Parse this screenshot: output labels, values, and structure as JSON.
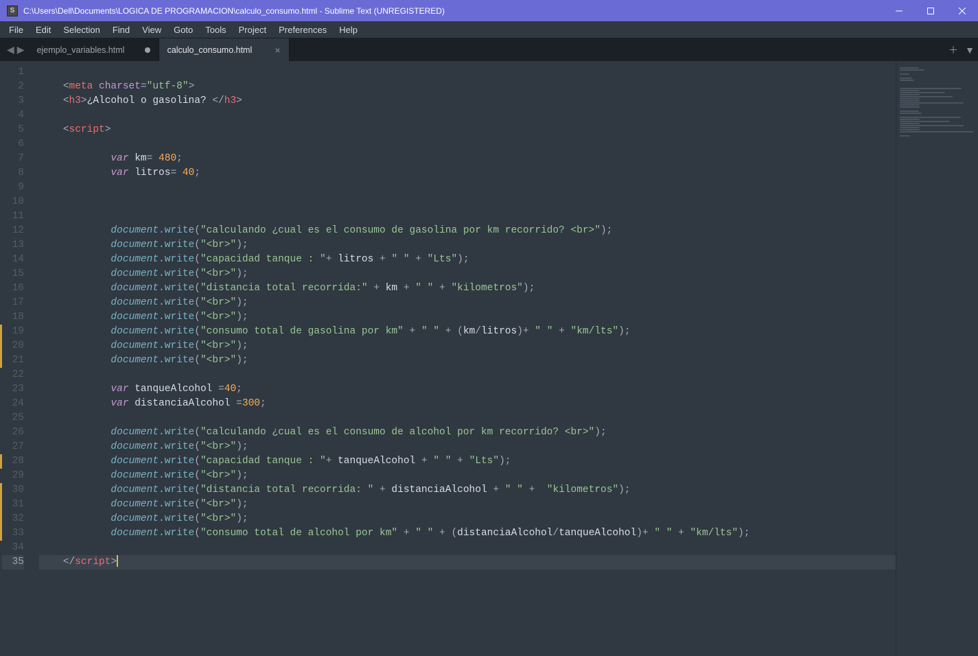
{
  "titlebar": {
    "title": "C:\\Users\\Dell\\Documents\\LOGICA DE PROGRAMACION\\calculo_consumo.html - Sublime Text (UNREGISTERED)"
  },
  "menu": [
    "File",
    "Edit",
    "Selection",
    "Find",
    "View",
    "Goto",
    "Tools",
    "Project",
    "Preferences",
    "Help"
  ],
  "tabs": [
    {
      "label": "ejemplo_variables.html",
      "active": false,
      "dirty": true
    },
    {
      "label": "calculo_consumo.html",
      "active": true,
      "dirty": false
    }
  ],
  "modified_lines": [
    19,
    20,
    21,
    28,
    30,
    31,
    32,
    33
  ],
  "code_lines": [
    {
      "n": 1,
      "segs": []
    },
    {
      "n": 2,
      "segs": [
        {
          "t": "<",
          "c": "pun"
        },
        {
          "t": "meta",
          "c": "tag"
        },
        {
          "t": " ",
          "c": "pun"
        },
        {
          "t": "charset",
          "c": "attr"
        },
        {
          "t": "=",
          "c": "pun"
        },
        {
          "t": "\"utf-8\"",
          "c": "str"
        },
        {
          "t": ">",
          "c": "pun"
        }
      ]
    },
    {
      "n": 3,
      "segs": [
        {
          "t": "<",
          "c": "pun"
        },
        {
          "t": "h3",
          "c": "tag"
        },
        {
          "t": ">",
          "c": "pun"
        },
        {
          "t": "¿Alcohol o gasolina? ",
          "c": "txt"
        },
        {
          "t": "</",
          "c": "pun"
        },
        {
          "t": "h3",
          "c": "tag"
        },
        {
          "t": ">",
          "c": "pun"
        }
      ]
    },
    {
      "n": 4,
      "segs": []
    },
    {
      "n": 5,
      "segs": [
        {
          "t": "<",
          "c": "pun"
        },
        {
          "t": "script",
          "c": "tag"
        },
        {
          "t": ">",
          "c": "pun"
        }
      ]
    },
    {
      "n": 6,
      "segs": []
    },
    {
      "n": 7,
      "indent": 2,
      "segs": [
        {
          "t": "var",
          "c": "kw"
        },
        {
          "t": " km",
          "c": "varn"
        },
        {
          "t": "= ",
          "c": "pun"
        },
        {
          "t": "480",
          "c": "num"
        },
        {
          "t": ";",
          "c": "pun"
        }
      ]
    },
    {
      "n": 8,
      "indent": 2,
      "segs": [
        {
          "t": "var",
          "c": "kw"
        },
        {
          "t": " litros",
          "c": "varn"
        },
        {
          "t": "= ",
          "c": "pun"
        },
        {
          "t": "40",
          "c": "num"
        },
        {
          "t": ";",
          "c": "pun"
        }
      ]
    },
    {
      "n": 9,
      "segs": []
    },
    {
      "n": 10,
      "segs": []
    },
    {
      "n": 11,
      "segs": []
    },
    {
      "n": 12,
      "indent": 2,
      "segs": [
        {
          "t": "document",
          "c": "obj"
        },
        {
          "t": ".",
          "c": "pun"
        },
        {
          "t": "write",
          "c": "mem"
        },
        {
          "t": "(",
          "c": "pun"
        },
        {
          "t": "\"calculando ¿cual es el consumo de gasolina por km recorrido? <br>\"",
          "c": "str"
        },
        {
          "t": ");",
          "c": "pun"
        }
      ]
    },
    {
      "n": 13,
      "indent": 2,
      "segs": [
        {
          "t": "document",
          "c": "obj"
        },
        {
          "t": ".",
          "c": "pun"
        },
        {
          "t": "write",
          "c": "mem"
        },
        {
          "t": "(",
          "c": "pun"
        },
        {
          "t": "\"<br>\"",
          "c": "str"
        },
        {
          "t": ");",
          "c": "pun"
        }
      ]
    },
    {
      "n": 14,
      "indent": 2,
      "segs": [
        {
          "t": "document",
          "c": "obj"
        },
        {
          "t": ".",
          "c": "pun"
        },
        {
          "t": "write",
          "c": "mem"
        },
        {
          "t": "(",
          "c": "pun"
        },
        {
          "t": "\"capacidad tanque : \"",
          "c": "str"
        },
        {
          "t": "+ ",
          "c": "pun"
        },
        {
          "t": "litros",
          "c": "varn"
        },
        {
          "t": " + ",
          "c": "pun"
        },
        {
          "t": "\" \"",
          "c": "str"
        },
        {
          "t": " + ",
          "c": "pun"
        },
        {
          "t": "\"Lts\"",
          "c": "str"
        },
        {
          "t": ");",
          "c": "pun"
        }
      ]
    },
    {
      "n": 15,
      "indent": 2,
      "segs": [
        {
          "t": "document",
          "c": "obj"
        },
        {
          "t": ".",
          "c": "pun"
        },
        {
          "t": "write",
          "c": "mem"
        },
        {
          "t": "(",
          "c": "pun"
        },
        {
          "t": "\"<br>\"",
          "c": "str"
        },
        {
          "t": ");",
          "c": "pun"
        }
      ]
    },
    {
      "n": 16,
      "indent": 2,
      "segs": [
        {
          "t": "document",
          "c": "obj"
        },
        {
          "t": ".",
          "c": "pun"
        },
        {
          "t": "write",
          "c": "mem"
        },
        {
          "t": "(",
          "c": "pun"
        },
        {
          "t": "\"distancia total recorrida:\"",
          "c": "str"
        },
        {
          "t": " + ",
          "c": "pun"
        },
        {
          "t": "km",
          "c": "varn"
        },
        {
          "t": " + ",
          "c": "pun"
        },
        {
          "t": "\" \"",
          "c": "str"
        },
        {
          "t": " + ",
          "c": "pun"
        },
        {
          "t": "\"kilometros\"",
          "c": "str"
        },
        {
          "t": ");",
          "c": "pun"
        }
      ]
    },
    {
      "n": 17,
      "indent": 2,
      "segs": [
        {
          "t": "document",
          "c": "obj"
        },
        {
          "t": ".",
          "c": "pun"
        },
        {
          "t": "write",
          "c": "mem"
        },
        {
          "t": "(",
          "c": "pun"
        },
        {
          "t": "\"<br>\"",
          "c": "str"
        },
        {
          "t": ");",
          "c": "pun"
        }
      ]
    },
    {
      "n": 18,
      "indent": 2,
      "segs": [
        {
          "t": "document",
          "c": "obj"
        },
        {
          "t": ".",
          "c": "pun"
        },
        {
          "t": "write",
          "c": "mem"
        },
        {
          "t": "(",
          "c": "pun"
        },
        {
          "t": "\"<br>\"",
          "c": "str"
        },
        {
          "t": ");",
          "c": "pun"
        }
      ]
    },
    {
      "n": 19,
      "indent": 2,
      "segs": [
        {
          "t": "document",
          "c": "obj"
        },
        {
          "t": ".",
          "c": "pun"
        },
        {
          "t": "write",
          "c": "mem"
        },
        {
          "t": "(",
          "c": "pun"
        },
        {
          "t": "\"consumo total de gasolina por km\"",
          "c": "str"
        },
        {
          "t": " + ",
          "c": "pun"
        },
        {
          "t": "\" \"",
          "c": "str"
        },
        {
          "t": " + (",
          "c": "pun"
        },
        {
          "t": "km",
          "c": "varn"
        },
        {
          "t": "/",
          "c": "pun"
        },
        {
          "t": "litros",
          "c": "varn"
        },
        {
          "t": ")+ ",
          "c": "pun"
        },
        {
          "t": "\" \"",
          "c": "str"
        },
        {
          "t": " + ",
          "c": "pun"
        },
        {
          "t": "\"km/lts\"",
          "c": "str"
        },
        {
          "t": ");",
          "c": "pun"
        }
      ]
    },
    {
      "n": 20,
      "indent": 2,
      "segs": [
        {
          "t": "document",
          "c": "obj"
        },
        {
          "t": ".",
          "c": "pun"
        },
        {
          "t": "write",
          "c": "mem"
        },
        {
          "t": "(",
          "c": "pun"
        },
        {
          "t": "\"<br>\"",
          "c": "str"
        },
        {
          "t": ");",
          "c": "pun"
        }
      ]
    },
    {
      "n": 21,
      "indent": 2,
      "segs": [
        {
          "t": "document",
          "c": "obj"
        },
        {
          "t": ".",
          "c": "pun"
        },
        {
          "t": "write",
          "c": "mem"
        },
        {
          "t": "(",
          "c": "pun"
        },
        {
          "t": "\"<br>\"",
          "c": "str"
        },
        {
          "t": ");",
          "c": "pun"
        }
      ]
    },
    {
      "n": 22,
      "segs": []
    },
    {
      "n": 23,
      "indent": 2,
      "segs": [
        {
          "t": "var",
          "c": "kw"
        },
        {
          "t": " tanqueAlcohol ",
          "c": "varn"
        },
        {
          "t": "=",
          "c": "pun"
        },
        {
          "t": "40",
          "c": "num"
        },
        {
          "t": ";",
          "c": "pun"
        }
      ]
    },
    {
      "n": 24,
      "indent": 2,
      "segs": [
        {
          "t": "var",
          "c": "kw"
        },
        {
          "t": " distanciaAlcohol ",
          "c": "varn"
        },
        {
          "t": "=",
          "c": "pun"
        },
        {
          "t": "300",
          "c": "num"
        },
        {
          "t": ";",
          "c": "pun"
        }
      ]
    },
    {
      "n": 25,
      "segs": []
    },
    {
      "n": 26,
      "indent": 2,
      "segs": [
        {
          "t": "document",
          "c": "obj"
        },
        {
          "t": ".",
          "c": "pun"
        },
        {
          "t": "write",
          "c": "mem"
        },
        {
          "t": "(",
          "c": "pun"
        },
        {
          "t": "\"calculando ¿cual es el consumo de alcohol por km recorrido? <br>\"",
          "c": "str"
        },
        {
          "t": ");",
          "c": "pun"
        }
      ]
    },
    {
      "n": 27,
      "indent": 2,
      "segs": [
        {
          "t": "document",
          "c": "obj"
        },
        {
          "t": ".",
          "c": "pun"
        },
        {
          "t": "write",
          "c": "mem"
        },
        {
          "t": "(",
          "c": "pun"
        },
        {
          "t": "\"<br>\"",
          "c": "str"
        },
        {
          "t": ");",
          "c": "pun"
        }
      ]
    },
    {
      "n": 28,
      "indent": 2,
      "segs": [
        {
          "t": "document",
          "c": "obj"
        },
        {
          "t": ".",
          "c": "pun"
        },
        {
          "t": "write",
          "c": "mem"
        },
        {
          "t": "(",
          "c": "pun"
        },
        {
          "t": "\"capacidad tanque : \"",
          "c": "str"
        },
        {
          "t": "+ ",
          "c": "pun"
        },
        {
          "t": "tanqueAlcohol",
          "c": "varn"
        },
        {
          "t": " + ",
          "c": "pun"
        },
        {
          "t": "\" \"",
          "c": "str"
        },
        {
          "t": " + ",
          "c": "pun"
        },
        {
          "t": "\"Lts\"",
          "c": "str"
        },
        {
          "t": ");",
          "c": "pun"
        }
      ]
    },
    {
      "n": 29,
      "indent": 2,
      "segs": [
        {
          "t": "document",
          "c": "obj"
        },
        {
          "t": ".",
          "c": "pun"
        },
        {
          "t": "write",
          "c": "mem"
        },
        {
          "t": "(",
          "c": "pun"
        },
        {
          "t": "\"<br>\"",
          "c": "str"
        },
        {
          "t": ");",
          "c": "pun"
        }
      ]
    },
    {
      "n": 30,
      "indent": 2,
      "segs": [
        {
          "t": "document",
          "c": "obj"
        },
        {
          "t": ".",
          "c": "pun"
        },
        {
          "t": "write",
          "c": "mem"
        },
        {
          "t": "(",
          "c": "pun"
        },
        {
          "t": "\"distancia total recorrida: \"",
          "c": "str"
        },
        {
          "t": " + ",
          "c": "pun"
        },
        {
          "t": "distanciaAlcohol",
          "c": "varn"
        },
        {
          "t": " + ",
          "c": "pun"
        },
        {
          "t": "\" \"",
          "c": "str"
        },
        {
          "t": " +  ",
          "c": "pun"
        },
        {
          "t": "\"kilometros\"",
          "c": "str"
        },
        {
          "t": ");",
          "c": "pun"
        }
      ]
    },
    {
      "n": 31,
      "indent": 2,
      "segs": [
        {
          "t": "document",
          "c": "obj"
        },
        {
          "t": ".",
          "c": "pun"
        },
        {
          "t": "write",
          "c": "mem"
        },
        {
          "t": "(",
          "c": "pun"
        },
        {
          "t": "\"<br>\"",
          "c": "str"
        },
        {
          "t": ");",
          "c": "pun"
        }
      ]
    },
    {
      "n": 32,
      "indent": 2,
      "segs": [
        {
          "t": "document",
          "c": "obj"
        },
        {
          "t": ".",
          "c": "pun"
        },
        {
          "t": "write",
          "c": "mem"
        },
        {
          "t": "(",
          "c": "pun"
        },
        {
          "t": "\"<br>\"",
          "c": "str"
        },
        {
          "t": ");",
          "c": "pun"
        }
      ]
    },
    {
      "n": 33,
      "indent": 2,
      "segs": [
        {
          "t": "document",
          "c": "obj"
        },
        {
          "t": ".",
          "c": "pun"
        },
        {
          "t": "write",
          "c": "mem"
        },
        {
          "t": "(",
          "c": "pun"
        },
        {
          "t": "\"consumo total de alcohol por km\"",
          "c": "str"
        },
        {
          "t": " + ",
          "c": "pun"
        },
        {
          "t": "\" \"",
          "c": "str"
        },
        {
          "t": " + (",
          "c": "pun"
        },
        {
          "t": "distanciaAlcohol",
          "c": "varn"
        },
        {
          "t": "/",
          "c": "pun"
        },
        {
          "t": "tanqueAlcohol",
          "c": "varn"
        },
        {
          "t": ")+ ",
          "c": "pun"
        },
        {
          "t": "\" \"",
          "c": "str"
        },
        {
          "t": " + ",
          "c": "pun"
        },
        {
          "t": "\"km/lts\"",
          "c": "str"
        },
        {
          "t": ");",
          "c": "pun"
        }
      ]
    },
    {
      "n": 34,
      "segs": []
    },
    {
      "n": 35,
      "current": true,
      "segs": [
        {
          "t": "</",
          "c": "pun"
        },
        {
          "t": "script",
          "c": "tag"
        },
        {
          "t": ">",
          "c": "pun"
        },
        {
          "cursor": true
        }
      ]
    }
  ]
}
